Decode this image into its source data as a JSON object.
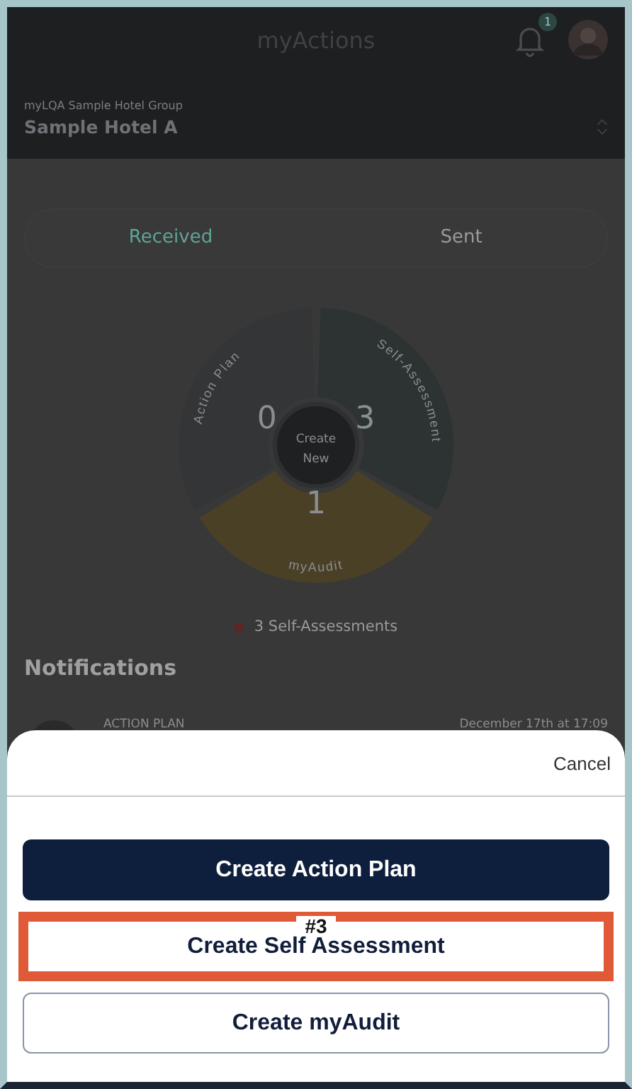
{
  "header": {
    "title": "myActions",
    "notification_badge": "1",
    "group": "myLQA Sample Hotel Group",
    "hotel": "Sample Hotel A"
  },
  "tabs": [
    {
      "label": "Received",
      "selected": true
    },
    {
      "label": "Sent",
      "selected": false
    }
  ],
  "wheel": {
    "center_label": "Create New",
    "segments": [
      {
        "label": "Self-Assessment",
        "count": "3",
        "color": "#2c3332"
      },
      {
        "label": "myAudit",
        "count": "1",
        "color": "#4a4026"
      },
      {
        "label": "Action Plan",
        "count": "0",
        "color": "#333536"
      }
    ]
  },
  "legend": [
    {
      "label": "3 Self-Assessments",
      "color": "#5c2626"
    }
  ],
  "notifications": {
    "title": "Notifications",
    "items": [
      {
        "type": "ACTION PLAN",
        "time": "December 17th at 17:09"
      }
    ]
  },
  "sheet": {
    "cancel": "Cancel",
    "buttons": [
      {
        "label": "Create Action Plan",
        "kind": "filled",
        "highlighted": false
      },
      {
        "label": "Create Self Assessment",
        "kind": "plain",
        "highlighted": true
      },
      {
        "label": "Create myAudit",
        "kind": "outline",
        "highlighted": false
      }
    ]
  },
  "annotation": {
    "label": "#3"
  }
}
